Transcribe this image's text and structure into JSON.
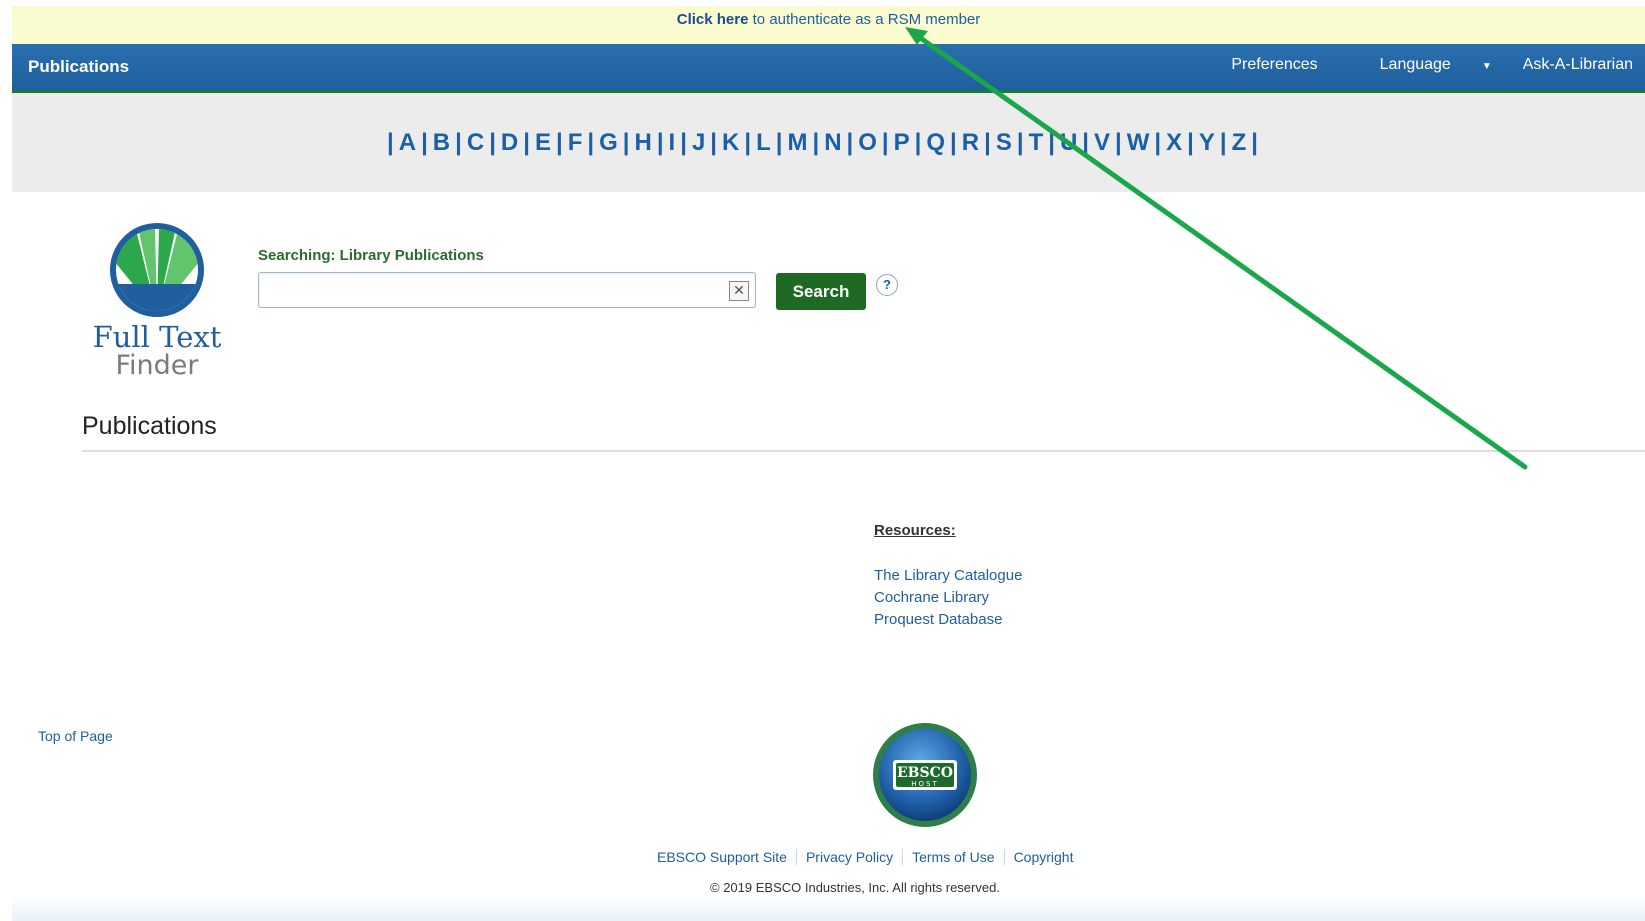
{
  "auth_banner": {
    "link_text": "Click here",
    "rest_text": " to authenticate as a RSM member"
  },
  "topnav": {
    "brand": "Publications",
    "preferences": "Preferences",
    "language": "Language",
    "ask_librarian": "Ask-A-Librarian"
  },
  "alphabet": [
    "A",
    "B",
    "C",
    "D",
    "E",
    "F",
    "G",
    "H",
    "I",
    "J",
    "K",
    "L",
    "M",
    "N",
    "O",
    "P",
    "Q",
    "R",
    "S",
    "T",
    "U",
    "V",
    "W",
    "X",
    "Y",
    "Z"
  ],
  "logo": {
    "line1": "Full Text",
    "line2": "Finder"
  },
  "search": {
    "label": "Searching: Library Publications",
    "value": "",
    "button": "Search",
    "help": "?"
  },
  "publications_heading": "Publications",
  "resources": {
    "title": "Resources:",
    "links": [
      "The Library Catalogue",
      "Cochrane Library",
      "Proquest Database"
    ]
  },
  "footer": {
    "top_of_page": "Top of Page",
    "links": [
      "EBSCO Support Site",
      "Privacy Policy",
      "Terms of Use",
      "Copyright"
    ],
    "copyright": "© 2019 EBSCO Industries, Inc. All rights reserved.",
    "ebsco_logo_text": "EBSCO",
    "ebsco_logo_sub": "HOST"
  },
  "colors": {
    "nav_blue": "#1f5f9d",
    "accent_green": "#1e6a23",
    "banner_yellow": "#fbfbd0",
    "annotation_arrow": "#1aa64a"
  }
}
